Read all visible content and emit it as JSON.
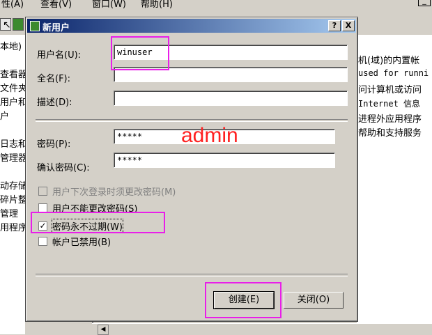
{
  "background": {
    "menu": [
      "性(A)",
      "查看(V)",
      "窗口(W)",
      "帮助(H)"
    ],
    "left_items": [
      "本地)",
      "查看器",
      "文件夹",
      "用户和",
      "户",
      "日志和",
      "管理器",
      "动存储",
      "碎片整",
      "管理",
      "用程序"
    ],
    "right_items": [
      {
        "text": "机(域)的内置帐",
        "mono": false
      },
      {
        "text": "used for runni",
        "mono": true
      },
      {
        "text": "问计算机或访问",
        "mono": false
      },
      {
        "text": " Internet 信息",
        "mono": true
      },
      {
        "text": "进程外应用程序",
        "mono": false
      },
      {
        "text": "帮助和支持服务",
        "mono": false
      }
    ]
  },
  "dialog": {
    "title": "新用户",
    "help_glyph": "?",
    "close_glyph": "X",
    "username_label": "用户名(U):",
    "username_value": "winuser",
    "fullname_label": "全名(F):",
    "fullname_value": "",
    "description_label": "描述(D):",
    "description_value": "",
    "password_label": "密码(P):",
    "password_value": "*****",
    "confirm_label": "确认密码(C):",
    "confirm_value": "*****",
    "options": [
      {
        "label": "用户下次登录时须更改密码(M)",
        "checked": false,
        "disabled": true
      },
      {
        "label": "用户不能更改密码(S)",
        "checked": false,
        "disabled": false
      },
      {
        "label": "密码永不过期(W)",
        "checked": true,
        "disabled": false
      },
      {
        "label": "帐户已禁用(B)",
        "checked": false,
        "disabled": false
      }
    ],
    "create_button": "创建(E)",
    "close_button": "关闭(O)"
  },
  "annotation": {
    "text": "admin",
    "color": "#ff2020",
    "box_color": "#e91ee9"
  }
}
